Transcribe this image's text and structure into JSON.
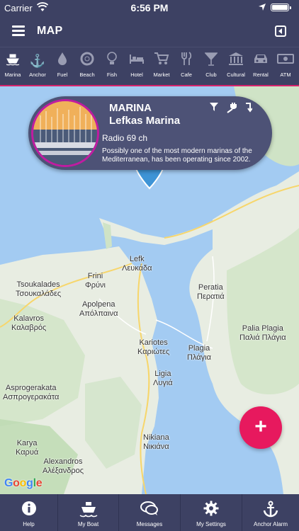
{
  "status_bar": {
    "carrier": "Carrier",
    "time": "6:56 PM"
  },
  "header": {
    "title": "MAP",
    "menu_icon": "hamburger-menu-icon",
    "exit_icon": "exit-icon"
  },
  "categories": [
    {
      "label": "Marina",
      "icon": "ship-icon",
      "active": true
    },
    {
      "label": "Anchor",
      "icon": "anchor-icon"
    },
    {
      "label": "Fuel",
      "icon": "fuel-drop-icon"
    },
    {
      "label": "Beach",
      "icon": "lifebuoy-icon"
    },
    {
      "label": "Fish",
      "icon": "lightbulb-icon"
    },
    {
      "label": "Hotel",
      "icon": "bed-icon"
    },
    {
      "label": "Market",
      "icon": "cart-icon"
    },
    {
      "label": "Cafe",
      "icon": "cutlery-icon"
    },
    {
      "label": "Club",
      "icon": "cocktail-icon"
    },
    {
      "label": "Cultural",
      "icon": "museum-icon"
    },
    {
      "label": "Rental",
      "icon": "car-icon"
    },
    {
      "label": "ATM",
      "icon": "cash-icon"
    }
  ],
  "card": {
    "type": "MARINA",
    "name": "Lefkas Marina",
    "radio": "Radio 69 ch",
    "description": "Possibly one of the most modern marinas of the Mediterranean, has been operating since 2002.",
    "actions": [
      "filter-icon",
      "plug-icon",
      "sort-icon"
    ]
  },
  "map": {
    "places": [
      {
        "name": "Lefk\nΛευκάδα"
      },
      {
        "name": "Tsoukalades\nΤσουκαλάδες"
      },
      {
        "name": "Frini\nΦρύνι"
      },
      {
        "name": "Peratia\nΠερατιά"
      },
      {
        "name": "Apolpena\nΑπόλπαινα"
      },
      {
        "name": "Kalavros\nΚαλαβρός"
      },
      {
        "name": "Palia Plagia\nΠαλιά Πλάγια"
      },
      {
        "name": "Kariotes\nΚαριώτες"
      },
      {
        "name": "Plagia\nΠλάγια"
      },
      {
        "name": "Ligia\nΛυγιά"
      },
      {
        "name": "Asprogerakata\nΑσπρογερακάτα"
      },
      {
        "name": "Karya\nΚαρυά"
      },
      {
        "name": "Nikiana\nΝικιάνα"
      },
      {
        "name": "Alexandros\nΑλέξανδρος"
      }
    ],
    "attribution": "Google"
  },
  "fab": {
    "label": "+"
  },
  "tabs": [
    {
      "label": "Help",
      "icon": "info-icon"
    },
    {
      "label": "My Boat",
      "icon": "boat-icon"
    },
    {
      "label": "Messages",
      "icon": "chat-icon"
    },
    {
      "label": "My Settings",
      "icon": "gear-icon"
    },
    {
      "label": "Anchor Alarm",
      "icon": "anchor-alarm-icon"
    }
  ],
  "colors": {
    "bar": "#3d4163",
    "accent": "#d6236d",
    "fab": "#e7195e",
    "pin": "#3e94d6",
    "card": "#4d5276",
    "water": "#a3cbf2",
    "land": "#e8ede2"
  }
}
